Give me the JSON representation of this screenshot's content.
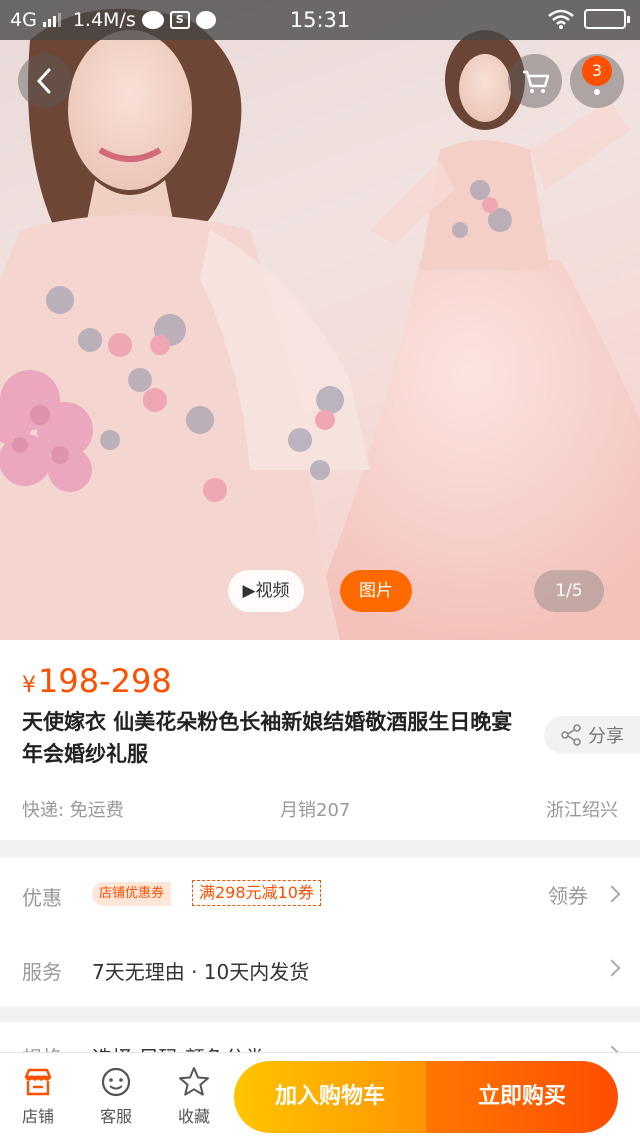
{
  "status_bar": {
    "network": "4G",
    "speed": "1.4M/s",
    "time": "15:31"
  },
  "header": {
    "cart_badge": "3"
  },
  "media": {
    "video_label": "▶视频",
    "image_label": "图片",
    "counter": "1/5"
  },
  "product": {
    "currency": "¥",
    "price": "198-298",
    "title": "天使嫁衣 仙美花朵粉色长袖新娘结婚敬酒服生日晚宴年会婚纱礼服",
    "share_label": "分享",
    "shipping": "快递: 免运费",
    "monthly_sales": "月销207",
    "location": "浙江绍兴"
  },
  "promo": {
    "label": "优惠",
    "shop_coupon_tag": "店铺优惠券",
    "coupon_text": "满298元减10券",
    "get_coupon": "领券"
  },
  "service": {
    "label": "服务",
    "text": "7天无理由 · 10天内发货"
  },
  "spec": {
    "label": "规格",
    "text": "选择 尺码 颜色分类"
  },
  "bottom_bar": {
    "shop": "店铺",
    "service": "客服",
    "favorite": "收藏",
    "add_to_cart": "加入购物车",
    "buy_now": "立即购买"
  },
  "colors": {
    "accent": "#ff5000",
    "cart_button": "#ffa500",
    "buy_button": "#ff5a00"
  },
  "icons": [
    "back-icon",
    "cart-icon",
    "more-icon",
    "share-icon",
    "shop-icon",
    "customer-service-icon",
    "star-icon",
    "chevron-right-icon"
  ]
}
